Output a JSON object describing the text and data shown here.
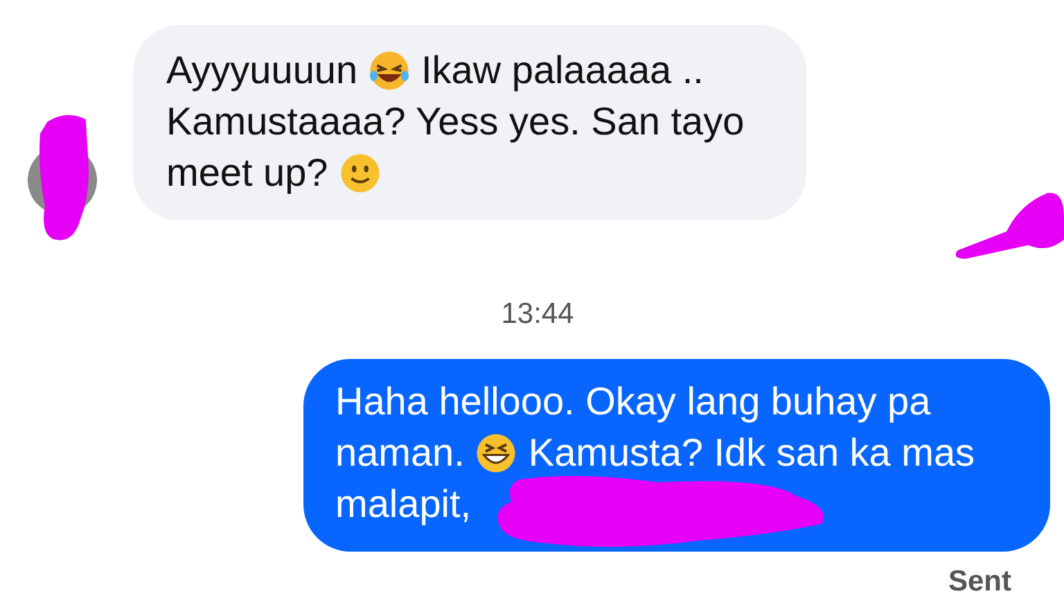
{
  "messages": [
    {
      "kind": "incoming",
      "lines": [
        [
          {
            "kind": "text",
            "text": "Ayyyuuuun"
          },
          {
            "kind": "tears"
          },
          {
            "kind": "text",
            "text": "Ikaw palaaaaa .."
          }
        ],
        [
          {
            "kind": "text",
            "text": "Kamustaaaa? Yess yes. San tayo"
          }
        ],
        [
          {
            "kind": "text",
            "text": "meet up?"
          },
          {
            "kind": "smile"
          }
        ]
      ]
    },
    {
      "kind": "time",
      "text": "13:44"
    },
    {
      "kind": "outgoing",
      "lines": [
        [
          {
            "kind": "text",
            "text": "Haha hellooo. Okay lang buhay pa"
          }
        ],
        [
          {
            "kind": "text",
            "text": "naman."
          },
          {
            "kind": "grin"
          },
          {
            "kind": "text",
            "text": "Kamusta? Idk san ka mas"
          }
        ],
        [
          {
            "kind": "text",
            "text": "malapit,"
          }
        ]
      ]
    },
    {
      "kind": "status",
      "text": "Sent"
    }
  ]
}
